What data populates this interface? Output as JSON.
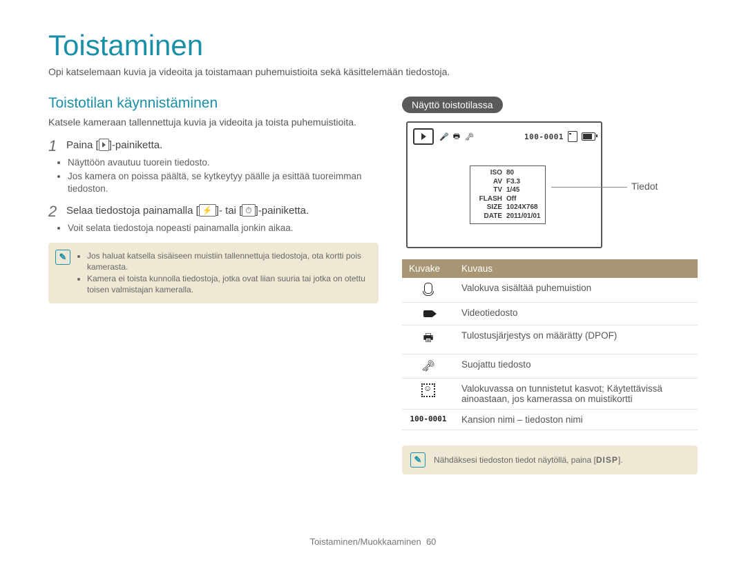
{
  "title": "Toistaminen",
  "intro": "Opi katselemaan kuvia ja videoita ja toistamaan puhemuistioita sekä käsittelemään tiedostoja.",
  "left": {
    "heading": "Toistotilan käynnistäminen",
    "lede": "Katsele kameraan tallennettuja kuvia ja videoita ja toista puhemuistioita.",
    "step1_num": "1",
    "step1_a": "Paina [",
    "step1_b": "]-painiketta.",
    "step1_bullets": [
      "Näyttöön avautuu tuorein tiedosto.",
      "Jos kamera on poissa päältä, se kytkeytyy päälle ja esittää tuoreimman tiedoston."
    ],
    "step2_num": "2",
    "step2_a": "Selaa tiedostoja painamalla [",
    "step2_mid": "]- tai [",
    "step2_b": "]-painiketta.",
    "step2_bullets": [
      "Voit selata tiedostoja nopeasti painamalla jonkin aikaa."
    ],
    "note": [
      "Jos haluat katsella sisäiseen muistiin tallennettuja tiedostoja, ota kortti pois kamerasta.",
      "Kamera ei toista kunnolla tiedostoja, jotka ovat liian suuria tai jotka on otettu toisen valmistajan kameralla."
    ]
  },
  "right": {
    "pill": "Näyttö toistotilassa",
    "info_label": "Tiedot",
    "hud_id": "100-0001",
    "info_rows": [
      {
        "lbl": "ISO",
        "val": "80"
      },
      {
        "lbl": "AV",
        "val": "F3.3"
      },
      {
        "lbl": "TV",
        "val": "1/45"
      },
      {
        "lbl": "FLASH",
        "val": "Off"
      },
      {
        "lbl": "SIZE",
        "val": "1024X768"
      },
      {
        "lbl": "DATE",
        "val": "2011/01/01"
      }
    ],
    "table_head": {
      "c1": "Kuvake",
      "c2": "Kuvaus"
    },
    "rows": [
      "Valokuva sisältää puhemuistion",
      "Videotiedosto",
      "Tulostusjärjestys on määrätty (DPOF)",
      "Suojattu tiedosto",
      "Valokuvassa on tunnistetut kasvot; Käytettävissä ainoastaan, jos kamerassa on muistikortti",
      "Kansion nimi – tiedoston nimi"
    ],
    "row6_icon": "100-0001",
    "tip_a": "Nähdäksesi tiedoston tiedot näytöllä, paina [",
    "tip_disp": "DISP",
    "tip_b": "]."
  },
  "footer_a": "Toistaminen/Muokkaaminen",
  "footer_page": "60"
}
